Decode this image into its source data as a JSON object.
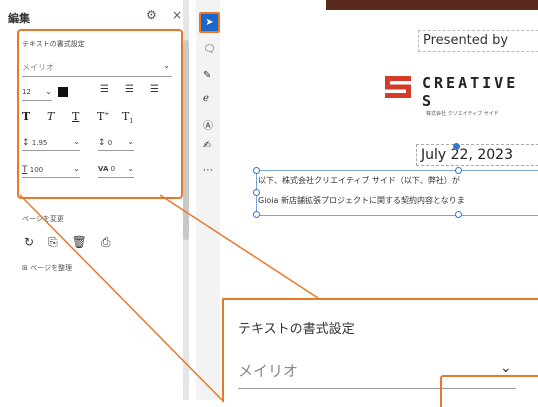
{
  "panel": {
    "title": "編集",
    "gear_glyph": "⚙",
    "close_glyph": "×",
    "text_format": {
      "title": "テキストの書式設定",
      "font": "メイリオ",
      "font_size": "12",
      "line_spacing": "1.95",
      "para_spacing": "0",
      "scale": "100",
      "char_spacing": "0"
    },
    "page_section": {
      "label": "ページを変更",
      "add_page": "ページを整理"
    }
  },
  "annotation": {
    "step_marker": "①"
  },
  "document": {
    "presented": "Presented by",
    "logo_text": "CREATIVE S",
    "logo_sub": "株式会社 クリエイティブ サイド",
    "date": "July 22, 2023",
    "body_line1": "以下、株式会社クリエイティブ サイド（以下、弊社）が",
    "body_line2": "Gioia 新店舗拡張プロジェクトに関する契約内容となりま"
  },
  "zoom": {
    "title": "テキストの書式設定",
    "font": "メイリオ"
  },
  "colors": {
    "accent": "#e8792b",
    "tool_active": "#1b66c9",
    "logo_red": "#d63b2a",
    "top_strip": "#5a2a1f"
  }
}
